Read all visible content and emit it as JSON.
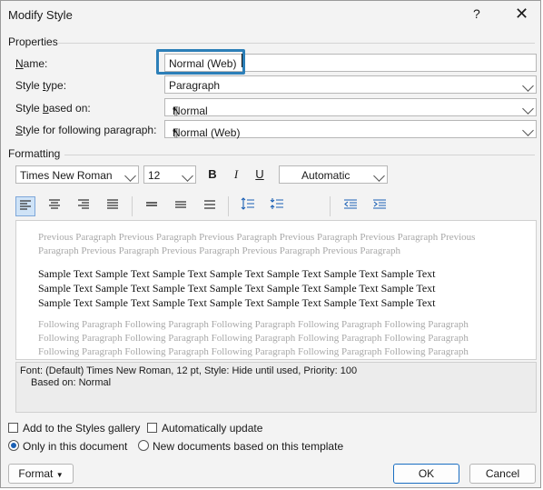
{
  "window": {
    "title": "Modify Style",
    "help_glyph": "?",
    "close_glyph": "✕"
  },
  "properties": {
    "header": "Properties",
    "name_label": "Name:",
    "name_value": "Normal (Web)",
    "style_type_label": "Style type:",
    "style_type_value": "Paragraph",
    "based_on_label": "Style based on:",
    "based_on_value": "Normal",
    "following_label": "Style for following paragraph:",
    "following_value": "Normal (Web)",
    "pilcrow": "¶"
  },
  "formatting": {
    "header": "Formatting",
    "font": "Times New Roman",
    "size": "12",
    "bold": "B",
    "italic": "I",
    "underline": "U",
    "color": "Automatic"
  },
  "preview": {
    "previous": [
      "Previous Paragraph Previous Paragraph Previous Paragraph Previous Paragraph Previous Paragraph Previous",
      "Paragraph Previous Paragraph Previous Paragraph Previous Paragraph Previous Paragraph"
    ],
    "sample": [
      "Sample Text Sample Text Sample Text Sample Text Sample Text Sample Text Sample Text",
      "Sample Text Sample Text Sample Text Sample Text Sample Text Sample Text Sample Text",
      "Sample Text Sample Text Sample Text Sample Text Sample Text Sample Text Sample Text"
    ],
    "following": [
      "Following Paragraph Following Paragraph Following Paragraph Following Paragraph Following Paragraph",
      "Following Paragraph Following Paragraph Following Paragraph Following Paragraph Following Paragraph",
      "Following Paragraph Following Paragraph Following Paragraph Following Paragraph Following Paragraph"
    ]
  },
  "description": {
    "line1": "Font: (Default) Times New Roman, 12 pt, Style: Hide until used, Priority: 100",
    "line2": "Based on: Normal"
  },
  "options": {
    "add_gallery": "Add to the Styles gallery",
    "auto_update": "Automatically update",
    "only_doc": "Only in this document",
    "new_docs": "New documents based on this template"
  },
  "buttons": {
    "format": "Format",
    "ok": "OK",
    "cancel": "Cancel"
  },
  "colors": {
    "focus_border": "#2c7fb8",
    "accent": "#1a6ec2"
  }
}
